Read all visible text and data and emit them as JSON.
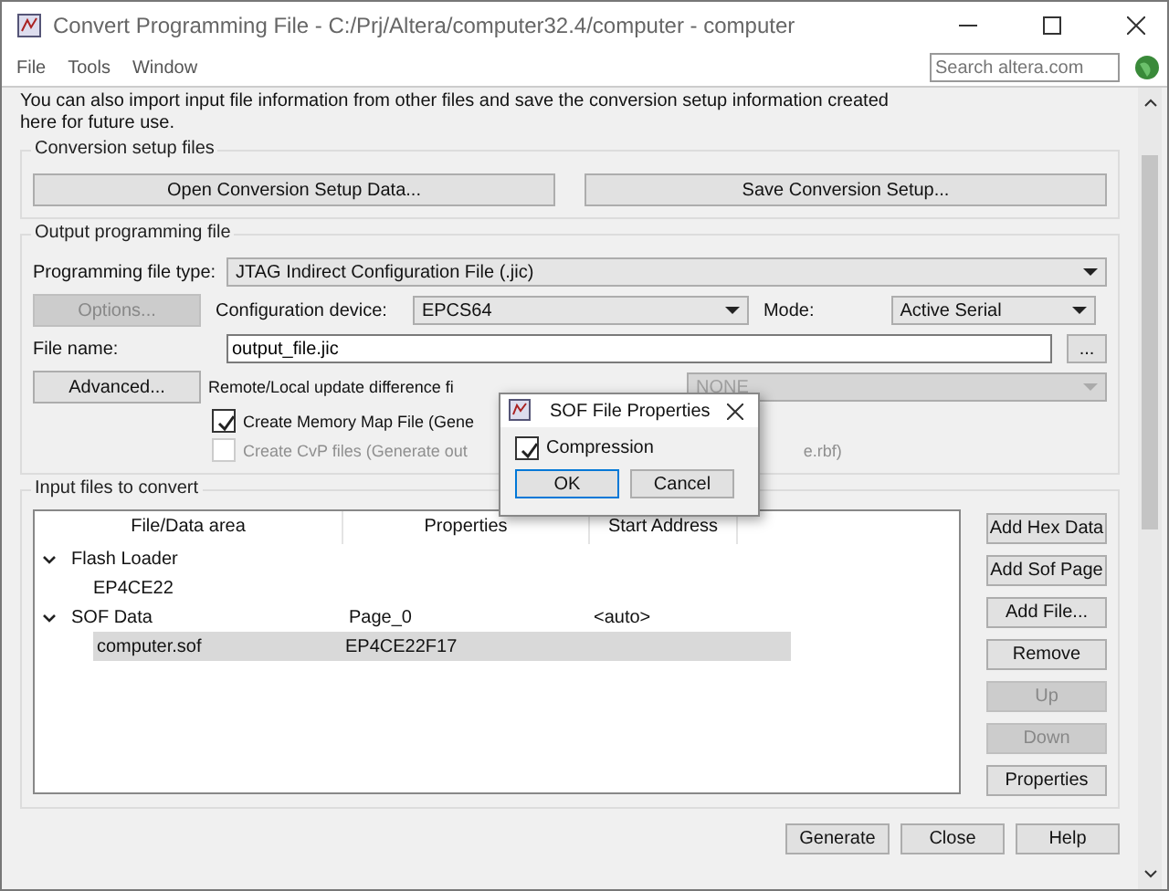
{
  "window": {
    "title": "Convert Programming File - C:/Prj/Altera/computer32.4/computer - computer"
  },
  "menu": [
    {
      "label": "File"
    },
    {
      "label": "Tools"
    },
    {
      "label": "Window"
    }
  ],
  "search": {
    "placeholder": "Search altera.com"
  },
  "intro": "You can also import input file information from other files and save the conversion setup information created here for future use.",
  "setup_group": {
    "title": "Conversion setup files",
    "buttons": [
      {
        "label": "Open Conversion Setup Data..."
      },
      {
        "label": "Save Conversion Setup..."
      }
    ]
  },
  "output_group": {
    "title": "Output programming file",
    "file_type": {
      "label": "Programming file type:",
      "value": "JTAG Indirect Configuration File (.jic)"
    },
    "options_button": {
      "label": "Options...",
      "disabled": true
    },
    "device": {
      "label": "Configuration device:",
      "value": "EPCS64"
    },
    "mode": {
      "label": "Mode:",
      "value": "Active Serial"
    },
    "file_name": {
      "label": "File name:",
      "value": "output_file.jic",
      "browse": "..."
    },
    "advanced_button": {
      "label": "Advanced...",
      "disabled": false
    },
    "remote": {
      "label": "Remote/Local update difference fi",
      "value": "NONE",
      "disabled": true
    },
    "checkboxes": [
      {
        "label": "Create Memory Map File (Gene",
        "checked": true,
        "disabled": false
      },
      {
        "label": "Create CvP files (Generate out",
        "tail": "e.rbf)",
        "checked": false,
        "disabled": true
      }
    ]
  },
  "input_group": {
    "title": "Input files to convert",
    "columns": [
      "File/Data area",
      "Properties",
      "Start Address"
    ],
    "rows": [
      {
        "cells": [
          "Flash Loader",
          "",
          ""
        ],
        "expanded": true,
        "selected": false,
        "children": [
          {
            "cells": [
              "EP4CE22",
              "",
              ""
            ],
            "selected": false
          }
        ]
      },
      {
        "cells": [
          "SOF Data",
          "Page_0",
          "<auto>"
        ],
        "expanded": true,
        "selected": false,
        "children": [
          {
            "cells": [
              "computer.sof",
              "EP4CE22F17",
              ""
            ],
            "selected": true
          }
        ]
      }
    ],
    "buttons": [
      {
        "label": "Add Hex Data",
        "disabled": false
      },
      {
        "label": "Add Sof Page",
        "disabled": false
      },
      {
        "label": "Add File...",
        "disabled": false
      },
      {
        "label": "Remove",
        "disabled": false
      },
      {
        "label": "Up",
        "disabled": true
      },
      {
        "label": "Down",
        "disabled": true
      },
      {
        "label": "Properties",
        "disabled": false
      }
    ]
  },
  "footer_buttons": [
    {
      "label": "Generate"
    },
    {
      "label": "Close"
    },
    {
      "label": "Help"
    }
  ],
  "dialog": {
    "title": "SOF File Properties",
    "checkbox": {
      "label": "Compression",
      "checked": true
    },
    "buttons": [
      {
        "label": "OK",
        "selected": true
      },
      {
        "label": "Cancel",
        "selected": false
      }
    ]
  }
}
